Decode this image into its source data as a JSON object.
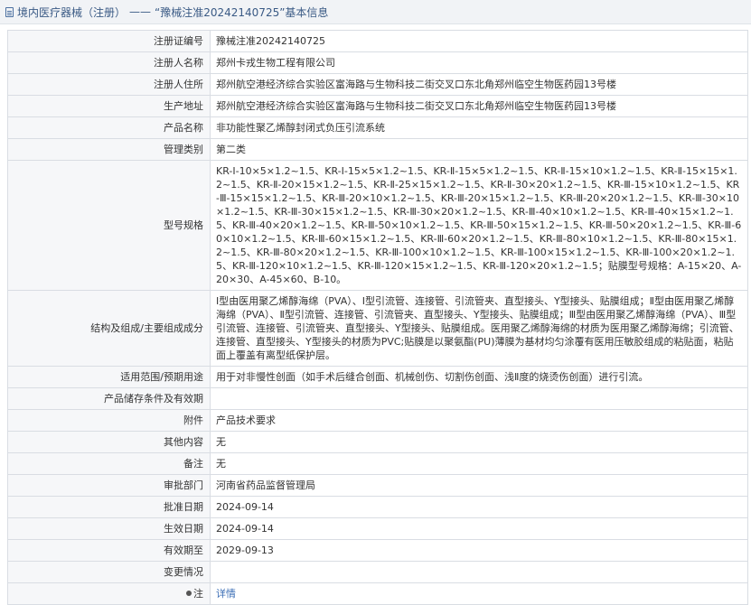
{
  "breadcrumb": {
    "section": "境内医疗器械（注册）",
    "separator": "——",
    "title": "“豫械注准20242140725”基本信息"
  },
  "rows": [
    {
      "label": "注册证编号",
      "value": "豫械注准20242140725"
    },
    {
      "label": "注册人名称",
      "value": "郑州卡戎生物工程有限公司"
    },
    {
      "label": "注册人住所",
      "value": "郑州航空港经济综合实验区富海路与生物科技二街交叉口东北角郑州临空生物医药园13号楼"
    },
    {
      "label": "生产地址",
      "value": "郑州航空港经济综合实验区富海路与生物科技二街交叉口东北角郑州临空生物医药园13号楼"
    },
    {
      "label": "产品名称",
      "value": "非功能性聚乙烯醇封闭式负压引流系统"
    },
    {
      "label": "管理类别",
      "value": "第二类"
    },
    {
      "label": "型号规格",
      "value": "KR-Ⅰ-10×5×1.2~1.5、KR-Ⅰ-15×5×1.2~1.5、KR-Ⅱ-15×5×1.2~1.5、KR-Ⅱ-15×10×1.2~1.5、KR-Ⅱ-15×15×1.2~1.5、KR-Ⅱ-20×15×1.2~1.5、KR-Ⅱ-25×15×1.2~1.5、KR-Ⅱ-30×20×1.2~1.5、KR-Ⅲ-15×10×1.2~1.5、KR-Ⅲ-15×15×1.2~1.5、KR-Ⅲ-20×10×1.2~1.5、KR-Ⅲ-20×15×1.2~1.5、KR-Ⅲ-20×20×1.2~1.5、KR-Ⅲ-30×10×1.2~1.5、KR-Ⅲ-30×15×1.2~1.5、KR-Ⅲ-30×20×1.2~1.5、KR-Ⅲ-40×10×1.2~1.5、KR-Ⅲ-40×15×1.2~1.5、KR-Ⅲ-40×20×1.2~1.5、KR-Ⅲ-50×10×1.2~1.5、KR-Ⅲ-50×15×1.2~1.5、KR-Ⅲ-50×20×1.2~1.5、KR-Ⅲ-60×10×1.2~1.5、KR-Ⅲ-60×15×1.2~1.5、KR-Ⅲ-60×20×1.2~1.5、KR-Ⅲ-80×10×1.2~1.5、KR-Ⅲ-80×15×1.2~1.5、KR-Ⅲ-80×20×1.2~1.5、KR-Ⅲ-100×10×1.2~1.5、KR-Ⅲ-100×15×1.2~1.5、KR-Ⅲ-100×20×1.2~1.5、KR-Ⅲ-120×10×1.2~1.5、KR-Ⅲ-120×15×1.2~1.5、KR-Ⅲ-120×20×1.2~1.5；贴膜型号规格：A-15×20、A-20×30、A-45×60、B-10。"
    },
    {
      "label": "结构及组成/主要组成成分",
      "value": "Ⅰ型由医用聚乙烯醇海绵（PVA）、Ⅰ型引流管、连接管、引流管夹、直型接头、Y型接头、贴膜组成；Ⅱ型由医用聚乙烯醇海绵（PVA）、Ⅱ型引流管、连接管、引流管夹、直型接头、Y型接头、贴膜组成；Ⅲ型由医用聚乙烯醇海绵（PVA）、Ⅲ型引流管、连接管、引流管夹、直型接头、Y型接头、贴膜组成。医用聚乙烯醇海绵的材质为医用聚乙烯醇海绵；引流管、连接管、直型接头、Y型接头的材质为PVC;贴膜是以聚氨酯(PU)薄膜为基材均匀涂覆有医用压敏胶组成的粘贴面，粘贴面上覆盖有离型纸保护层。"
    },
    {
      "label": "适用范围/预期用途",
      "value": "用于对非慢性创面（如手术后缝合创面、机械创伤、切割伤创面、浅Ⅱ度的烧烫伤创面）进行引流。"
    },
    {
      "label": "产品储存条件及有效期",
      "value": ""
    },
    {
      "label": "附件",
      "value": "产品技术要求"
    },
    {
      "label": "其他内容",
      "value": "无"
    },
    {
      "label": "备注",
      "value": "无"
    },
    {
      "label": "审批部门",
      "value": "河南省药品监督管理局"
    },
    {
      "label": "批准日期",
      "value": "2024-09-14"
    },
    {
      "label": "生效日期",
      "value": "2024-09-14"
    },
    {
      "label": "有效期至",
      "value": "2029-09-13"
    },
    {
      "label": "变更情况",
      "value": ""
    }
  ],
  "detail_row": {
    "label": "注",
    "link": "详情",
    "icon": "location-pin-icon"
  }
}
